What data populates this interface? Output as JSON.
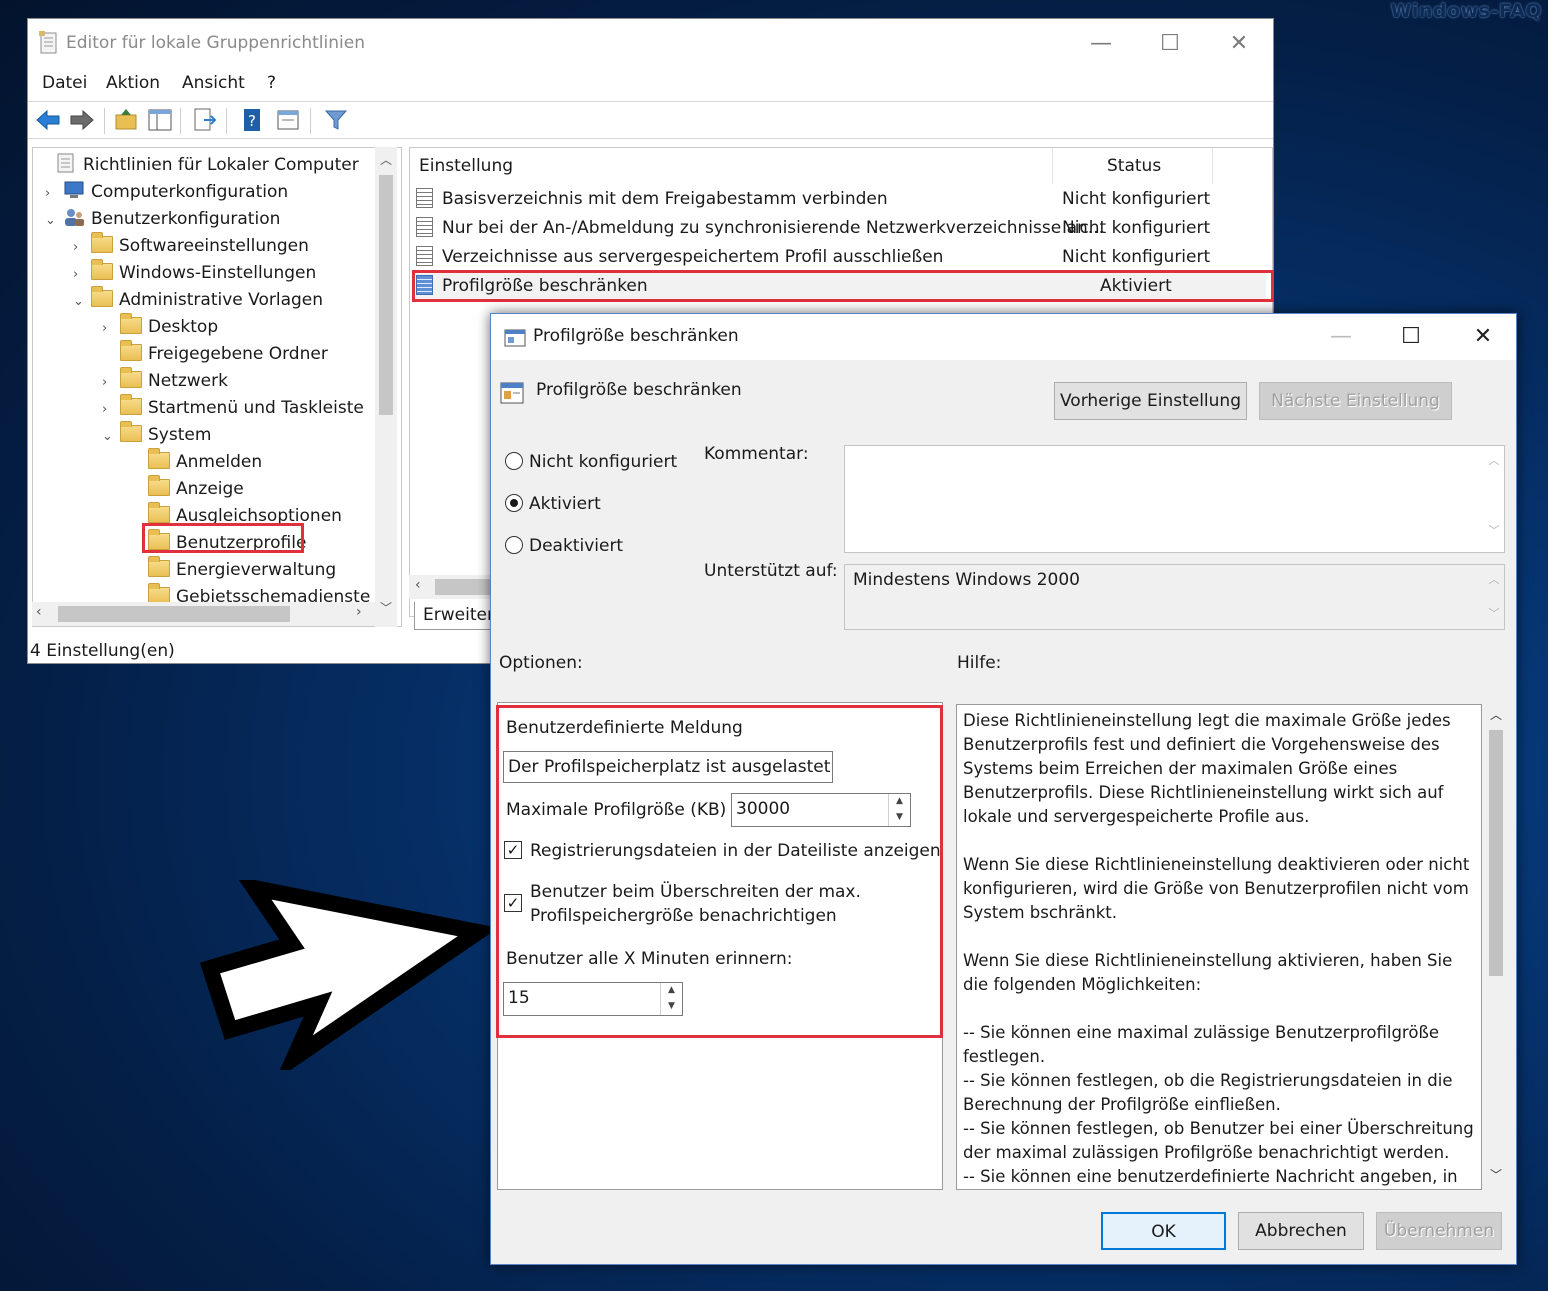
{
  "watermark": "Windows-FAQ",
  "main": {
    "title": "Editor für lokale Gruppenrichtlinien",
    "menu": [
      "Datei",
      "Aktion",
      "Ansicht",
      "?"
    ],
    "tree": {
      "items": [
        {
          "label": "Richtlinien für Lokaler Computer",
          "expander": "",
          "icon": "policy-icon"
        },
        {
          "label": "Computerkonfiguration",
          "expander": "›",
          "icon": "computer-icon"
        },
        {
          "label": "Benutzerkonfiguration",
          "expander": "⌄",
          "icon": "users-icon"
        },
        {
          "label": "Softwareeinstellungen",
          "expander": "›",
          "icon": "folder-icon"
        },
        {
          "label": "Windows-Einstellungen",
          "expander": "›",
          "icon": "folder-icon"
        },
        {
          "label": "Administrative Vorlagen",
          "expander": "⌄",
          "icon": "folder-icon"
        },
        {
          "label": "Desktop",
          "expander": "›",
          "icon": "folder-icon"
        },
        {
          "label": "Freigegebene Ordner",
          "expander": "",
          "icon": "folder-icon"
        },
        {
          "label": "Netzwerk",
          "expander": "›",
          "icon": "folder-icon"
        },
        {
          "label": "Startmenü und Taskleiste",
          "expander": "›",
          "icon": "folder-icon"
        },
        {
          "label": "System",
          "expander": "⌄",
          "icon": "folder-icon"
        },
        {
          "label": "Anmelden",
          "expander": "",
          "icon": "folder-icon"
        },
        {
          "label": "Anzeige",
          "expander": "",
          "icon": "folder-icon"
        },
        {
          "label": "Ausgleichsoptionen",
          "expander": "",
          "icon": "folder-icon"
        },
        {
          "label": "Benutzerprofile",
          "expander": "",
          "icon": "folder-icon"
        },
        {
          "label": "Energieverwaltung",
          "expander": "",
          "icon": "folder-icon"
        },
        {
          "label": "Gebietsschemadienste",
          "expander": "",
          "icon": "folder-icon"
        }
      ]
    },
    "list": {
      "col_setting": "Einstellung",
      "col_status": "Status",
      "rows": [
        {
          "setting": "Basisverzeichnis mit dem Freigabestamm verbinden",
          "status": "Nicht konfiguriert"
        },
        {
          "setting": "Nur bei der An-/Abmeldung zu synchronisierende Netzwerkverzeichnisse an...",
          "status": "Nicht konfiguriert"
        },
        {
          "setting": "Verzeichnisse aus servergespeichertem Profil ausschließen",
          "status": "Nicht konfiguriert"
        },
        {
          "setting": "Profilgröße beschränken",
          "status": "Aktiviert"
        }
      ]
    },
    "tab_extended": "Erweitert",
    "status_text": "4 Einstellung(en)"
  },
  "dialog": {
    "title": "Profilgröße beschränken",
    "heading": "Profilgröße beschränken",
    "prev_button": "Vorherige Einstellung",
    "next_button": "Nächste Einstellung",
    "radio_not_configured": "Nicht konfiguriert",
    "radio_enabled": "Aktiviert",
    "radio_disabled": "Deaktiviert",
    "comment_label": "Kommentar:",
    "supported_label": "Unterstützt auf:",
    "supported_value": "Mindestens Windows 2000",
    "options_label": "Optionen:",
    "help_label": "Hilfe:",
    "options": {
      "custom_message_label": "Benutzerdefinierte Meldung",
      "custom_message_value": "Der Profilspeicherplatz ist ausgelastet. Bev",
      "max_size_label": "Maximale Profilgröße (KB)",
      "max_size_value": "30000",
      "check_registry_label": "Registrierungsdateien in der Dateiliste anzeigen",
      "check_notify_label_1": "Benutzer beim Überschreiten der max.",
      "check_notify_label_2": "Profilspeichergröße benachrichtigen",
      "remind_label": "Benutzer alle X Minuten erinnern:",
      "remind_value": "15"
    },
    "help_text": "Diese Richtlinieneinstellung legt die maximale Größe jedes Benutzerprofils fest und definiert die Vorgehensweise des Systems beim Erreichen der maximalen Größe eines Benutzerprofils. Diese Richtlinieneinstellung wirkt sich auf lokale und servergespeicherte Profile aus.\n\nWenn Sie diese Richtlinieneinstellung deaktivieren oder nicht konfigurieren, wird die Größe von Benutzerprofilen nicht vom System bschränkt.\n\nWenn Sie diese Richtlinieneinstellung aktivieren, haben Sie die folgenden Möglichkeiten:\n\n-- Sie können eine maximal zulässige Benutzerprofilgröße festlegen.\n-- Sie können festlegen, ob die Registrierungsdateien in die Berechnung der Profilgröße einfließen.\n-- Sie können festlegen, ob Benutzer bei einer Überschreitung der maximal zulässigen Profilgröße benachrichtigt werden.\n-- Sie können eine benutzerdefinierte Nachricht angeben, in der",
    "ok_button": "OK",
    "cancel_button": "Abbrechen",
    "apply_button": "Übernehmen"
  }
}
